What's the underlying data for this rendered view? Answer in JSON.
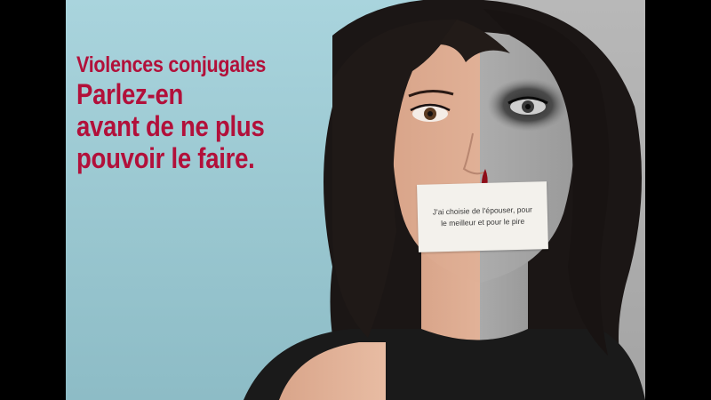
{
  "poster": {
    "headline": {
      "line1": "Violences conjugales",
      "line2": "Parlez-en",
      "line3": "avant de ne plus",
      "line4": "pouvoir le faire."
    },
    "tape_note": {
      "line1": "J'ai choisie de l'épouser, pour",
      "line2": "le meilleur et pour le pire"
    }
  },
  "colors": {
    "headline_red": "#b2103a",
    "background_blue": "#a9d4dd",
    "letterbox_black": "#000000"
  }
}
